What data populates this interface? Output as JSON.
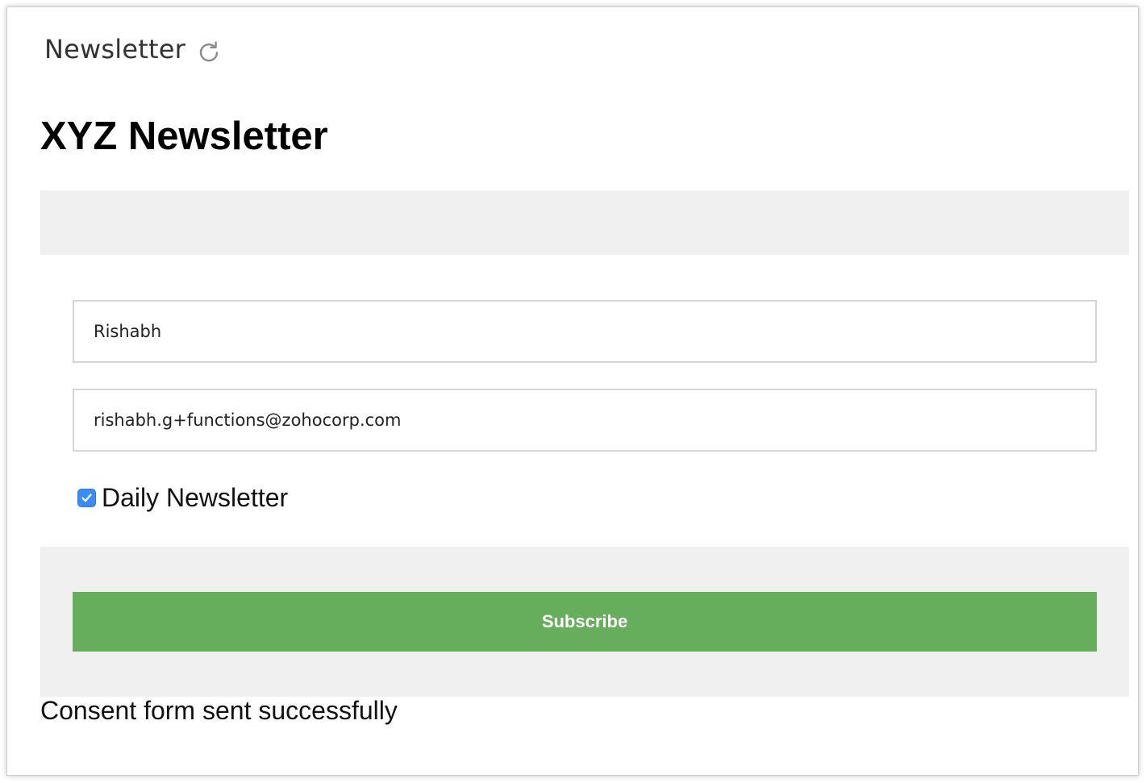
{
  "header": {
    "title": "Newsletter",
    "refresh_icon": "refresh-icon"
  },
  "form": {
    "title": "XYZ Newsletter",
    "name_value": "Rishabh",
    "email_value": "rishabh.g+functions@zohocorp.com",
    "checkbox_label": "Daily Newsletter",
    "checkbox_checked": true,
    "submit_label": "Subscribe"
  },
  "status": {
    "message": "Consent form sent successfully"
  },
  "colors": {
    "submit_button": "#66ad5c",
    "checkbox": "#3b8cf5",
    "band": "#f0f0f0"
  }
}
